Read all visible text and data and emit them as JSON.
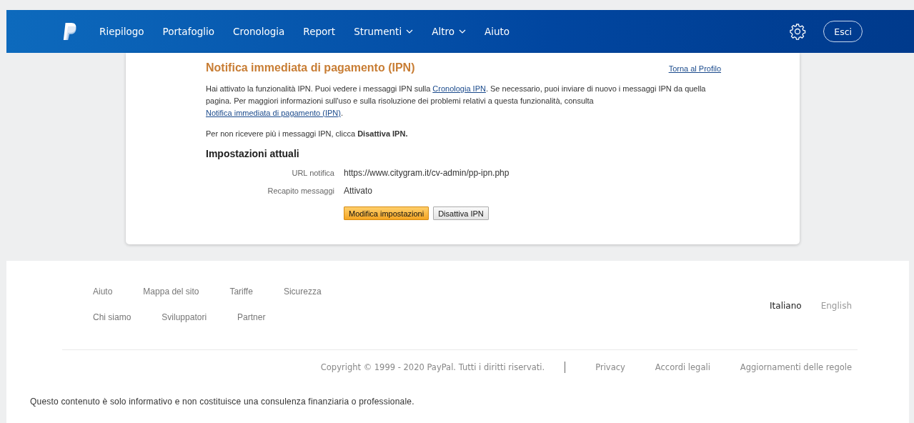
{
  "nav": {
    "items": [
      {
        "label": "Riepilogo",
        "dropdown": false
      },
      {
        "label": "Portafoglio",
        "dropdown": false
      },
      {
        "label": "Cronologia",
        "dropdown": false
      },
      {
        "label": "Report",
        "dropdown": false
      },
      {
        "label": "Strumenti",
        "dropdown": true
      },
      {
        "label": "Altro",
        "dropdown": true
      },
      {
        "label": "Aiuto",
        "dropdown": false
      }
    ],
    "logout": "Esci"
  },
  "card": {
    "title": "Notifica immediata di pagamento (IPN)",
    "back_link": "Torna al Profilo",
    "intro": [
      {
        "kind": "text",
        "text": "Hai attivato la funzionalità IPN. Puoi vedere i messaggi IPN sulla "
      },
      {
        "kind": "link",
        "text": "Cronologia IPN"
      },
      {
        "kind": "text",
        "text": ". Se necessario, puoi inviare di nuovo i messaggi IPN da quella pagina. Per maggiori informazioni sull'uso e sulla risoluzione dei problemi relativi a questa funzionalità, consulta "
      },
      {
        "kind": "link",
        "text": "Notifica immediata di pagamento (IPN)"
      },
      {
        "kind": "text",
        "text": "."
      }
    ],
    "disable_note": "Per non ricevere più i messaggi IPN, clicca **Disattiva IPN.**",
    "settings_title": "Impostazioni attuali",
    "settings": [
      {
        "label": "URL notifica",
        "value": "https://www.citygram.it/cv-admin/pp-ipn.php"
      },
      {
        "label": "Recapito messaggi",
        "value": "Attivato"
      }
    ],
    "buttons": [
      {
        "label": "Modifica impostazioni",
        "kind": "primary"
      },
      {
        "label": "Disattiva IPN",
        "kind": "secondary"
      }
    ]
  },
  "footer": {
    "links_row_1": [
      "Aiuto",
      "Mappa del sito",
      "Tariffe",
      "Sicurezza"
    ],
    "links_row_2": [
      "Chi siamo",
      "Sviluppatori",
      "Partner"
    ],
    "languages": [
      {
        "label": "Italiano",
        "selected": true
      },
      {
        "label": "English",
        "selected": false
      }
    ],
    "copyright": "Copyright © 1999 - 2020 PayPal. Tutti i diritti riservati.",
    "legal_links": [
      "Privacy",
      "Accordi legali",
      "Aggiornamenti delle regole"
    ],
    "disclaimer": "Questo contenuto è solo informativo e non costituisce una consulenza finanziaria o professionale."
  }
}
